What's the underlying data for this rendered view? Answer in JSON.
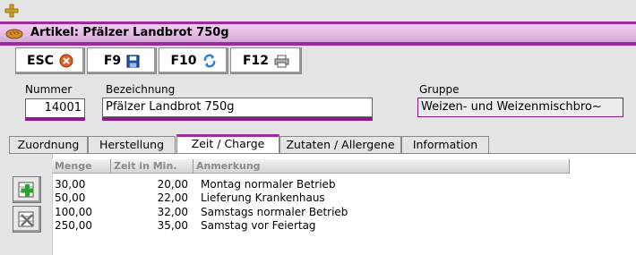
{
  "window": {
    "title": "Artikel: Pfälzer Landbrot 750g"
  },
  "toolbar": [
    {
      "key": "ESC",
      "icon": "cancel-icon"
    },
    {
      "key": "F9",
      "icon": "save-icon"
    },
    {
      "key": "F10",
      "icon": "refresh-icon"
    },
    {
      "key": "F12",
      "icon": "print-icon"
    }
  ],
  "fields": {
    "nummer": {
      "label": "Nummer",
      "value": "14001"
    },
    "bezeichnung": {
      "label": "Bezeichnung",
      "value": "Pfälzer Landbrot 750g"
    },
    "gruppe": {
      "label": "Gruppe",
      "value": "Weizen- und Weizenmischbro~"
    }
  },
  "tabs": [
    {
      "label": "Zuordnung"
    },
    {
      "label": "Herstellung"
    },
    {
      "label": "Zeit / Charge"
    },
    {
      "label": "Zutaten / Allergene"
    },
    {
      "label": "Information"
    }
  ],
  "active_tab": "Zeit / Charge",
  "table": {
    "columns": [
      "Menge",
      "Zeit in Min.",
      "Anmerkung"
    ],
    "rows": [
      [
        "30,00",
        "20,00",
        "Montag normaler Betrieb"
      ],
      [
        "50,00",
        "22,00",
        "Lieferung Krankenhaus"
      ],
      [
        "100,00",
        "32,00",
        "Samstags normaler Betrieb"
      ],
      [
        "250,00",
        "35,00",
        "Samstag vor Feiertag"
      ]
    ]
  },
  "side_buttons": [
    {
      "icon": "add-row-icon"
    },
    {
      "icon": "delete-row-icon"
    }
  ],
  "colors": {
    "accent": "#9c2c9c",
    "underline": "#8a1a8a"
  }
}
